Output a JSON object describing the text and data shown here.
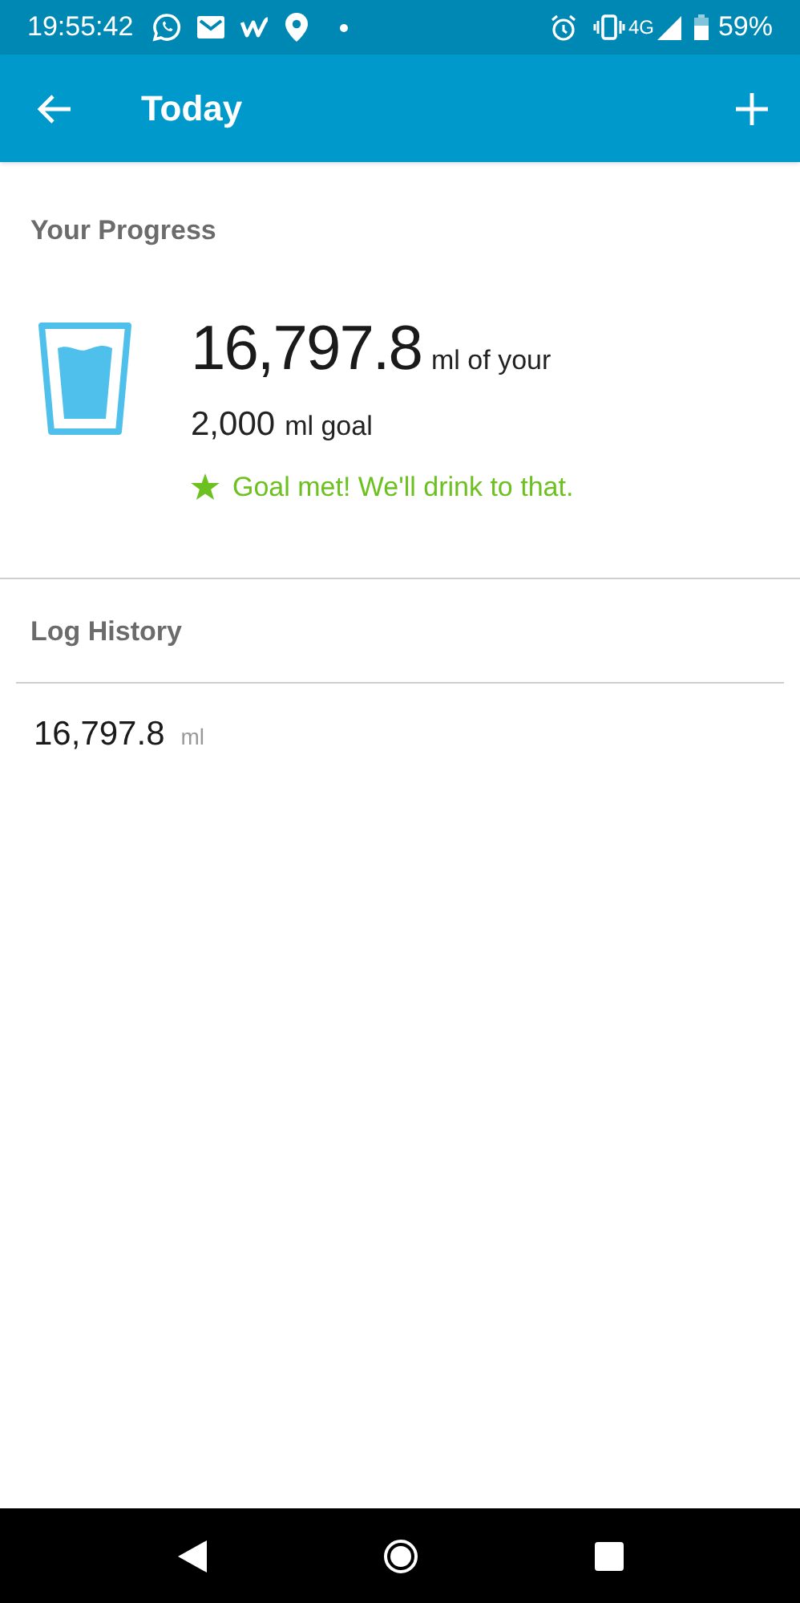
{
  "status_bar": {
    "time": "19:55:42",
    "network": "4G",
    "battery": "59%"
  },
  "app_bar": {
    "title": "Today"
  },
  "progress": {
    "heading": "Your Progress",
    "amount": "16,797.8",
    "amount_suffix": "ml of your",
    "goal": "2,000",
    "goal_suffix": "ml goal",
    "goal_met": true,
    "message": "Goal met! We'll drink to that."
  },
  "log_history": {
    "heading": "Log History",
    "entries": [
      {
        "amount": "16,797.8",
        "unit": "ml"
      }
    ]
  }
}
